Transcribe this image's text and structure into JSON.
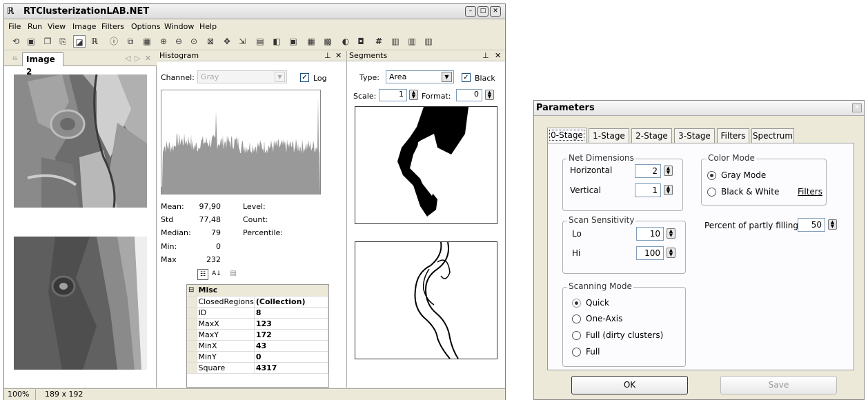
{
  "app": {
    "title": "RTClusterizationLAB.NET"
  },
  "menu": [
    "File",
    "Run",
    "View",
    "Image",
    "Filters",
    "Options",
    "Window",
    "Help"
  ],
  "doc_tab": {
    "label": "Image 2"
  },
  "histogram": {
    "title": "Histogram",
    "channel_label": "Channel:",
    "channel_value": "Gray",
    "log_label": "Log",
    "stats": {
      "mean_label": "Mean:",
      "mean": "97,90",
      "std_label": "Std",
      "std": "77,48",
      "median_label": "Median:",
      "median": "79",
      "min_label": "Min:",
      "min": "0",
      "max_label": "Max",
      "max": "232",
      "level_label": "Level:",
      "count_label": "Count:",
      "percentile_label": "Percentile:"
    }
  },
  "propgrid": {
    "category": "Misc",
    "rows": [
      [
        "ClosedRegions",
        "(Collection)"
      ],
      [
        "ID",
        "8"
      ],
      [
        "MaxX",
        "123"
      ],
      [
        "MaxY",
        "172"
      ],
      [
        "MinX",
        "43"
      ],
      [
        "MinY",
        "0"
      ],
      [
        "Square",
        "4317"
      ]
    ]
  },
  "segments": {
    "title": "Segments",
    "type_label": "Type:",
    "type_value": "Area",
    "black_label": "Black",
    "scale_label": "Scale:",
    "scale_value": "1",
    "format_label": "Format:",
    "format_value": "0"
  },
  "status": {
    "zoom": "100%",
    "size": "189 x 192"
  },
  "dialog": {
    "title": "Parameters",
    "tabs": [
      "0-Stage",
      "1-Stage",
      "2-Stage",
      "3-Stage",
      "Filters",
      "Spectrum"
    ],
    "net": {
      "title": "Net Dimensions",
      "h_label": "Horizontal",
      "h": "2",
      "v_label": "Vertical",
      "v": "1"
    },
    "scan": {
      "title": "Scan Sensitivity",
      "lo_label": "Lo",
      "lo": "10",
      "hi_label": "Hi",
      "hi": "100"
    },
    "mode": {
      "title": "Scanning Mode",
      "options": [
        "Quick",
        "One-Axis",
        "Full (dirty clusters)",
        "Full"
      ]
    },
    "color": {
      "title": "Color Mode",
      "gray": "Gray Mode",
      "bw": "Black & White",
      "filters_link": "Filters"
    },
    "percent": {
      "label": "Percent of partly filling",
      "value": "50"
    },
    "ok": "OK",
    "save": "Save"
  }
}
